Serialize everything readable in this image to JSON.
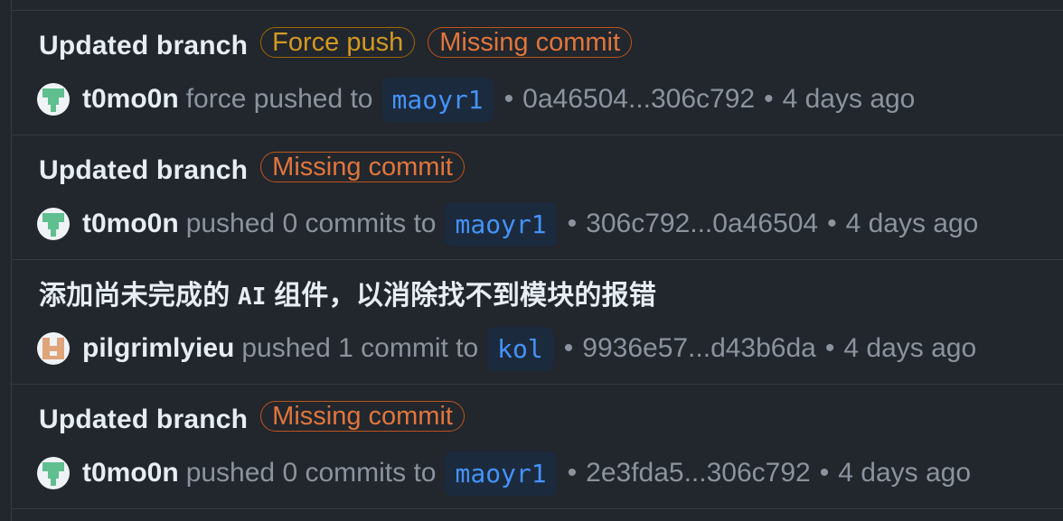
{
  "entries": [
    {
      "title": "Updated branch",
      "badges": {
        "force": "Force push",
        "missing": "Missing commit"
      },
      "user": "t0mo0n",
      "action": "force pushed to",
      "branch": "maoyr1",
      "sep1": "•",
      "range": "0a46504...306c792",
      "sep2": "•",
      "time": "4 days ago",
      "avatar_color": "#5fbf8f"
    },
    {
      "title": "Updated branch",
      "badges": {
        "missing": "Missing commit"
      },
      "user": "t0mo0n",
      "action": "pushed 0 commits to",
      "branch": "maoyr1",
      "sep1": "•",
      "range": "306c792...0a46504",
      "sep2": "•",
      "time": "4 days ago",
      "avatar_color": "#5fbf8f"
    },
    {
      "title_pre": "添加尚未完成的",
      "title_code": "AI",
      "title_post": "组件，以消除找不到模块的报错",
      "user": "pilgrimlyieu",
      "action": "pushed 1 commit to",
      "branch": "kol",
      "sep1": "•",
      "range": "9936e57...d43b6da",
      "sep2": "•",
      "time": "4 days ago",
      "avatar_color": "#e0a47a"
    },
    {
      "title": "Updated branch",
      "badges": {
        "missing": "Missing commit"
      },
      "user": "t0mo0n",
      "action": "pushed 0 commits to",
      "branch": "maoyr1",
      "sep1": "•",
      "range": "2e3fda5...306c792",
      "sep2": "•",
      "time": "4 days ago",
      "avatar_color": "#5fbf8f"
    }
  ],
  "colors": {
    "background": "#22262d",
    "force_badge": "#d29922",
    "missing_badge": "#e0763c",
    "branch_text": "#4493f8",
    "muted_text": "#8b949e"
  }
}
